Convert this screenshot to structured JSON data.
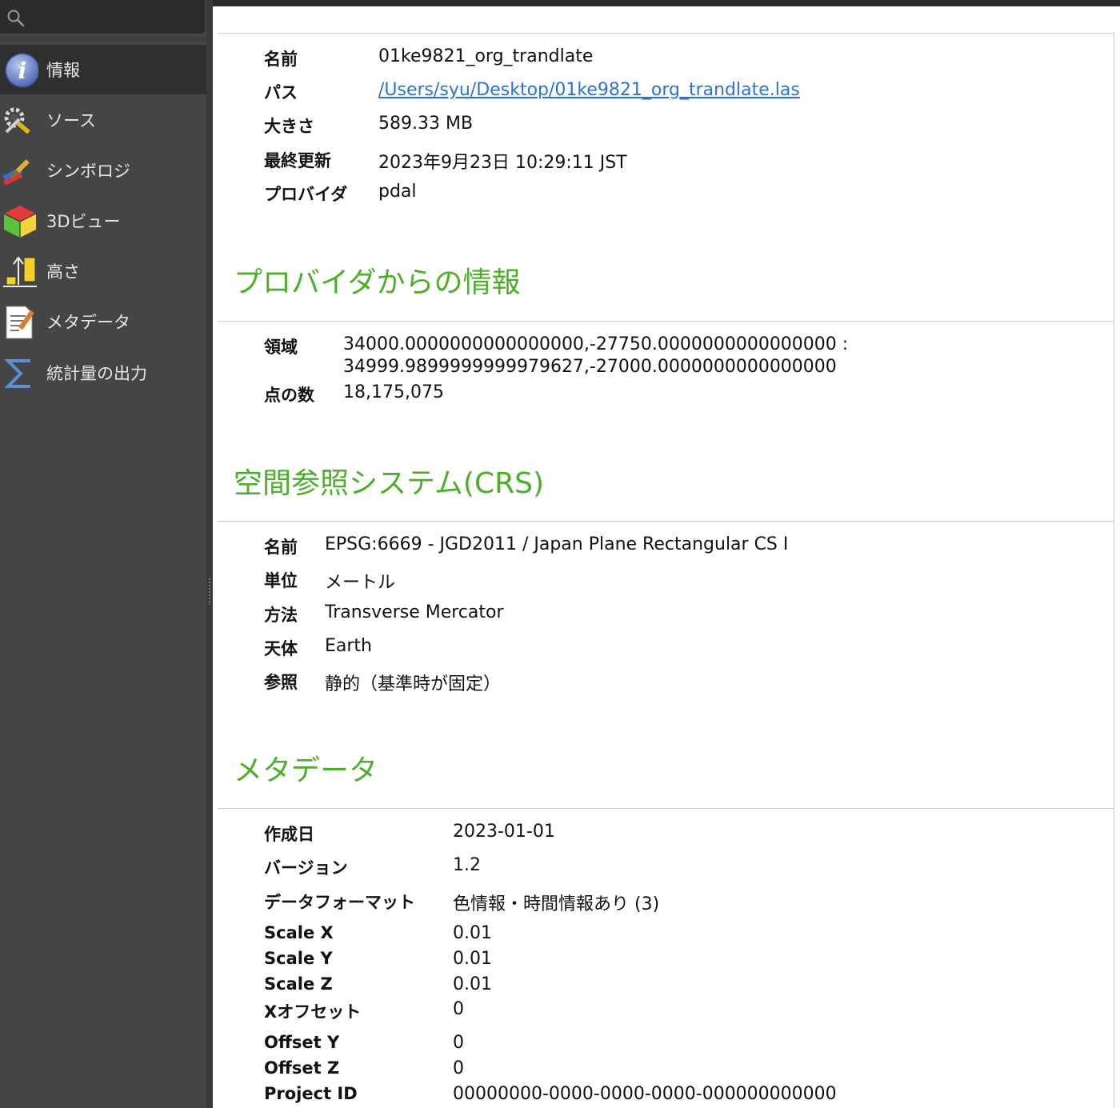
{
  "sidebar": {
    "search_placeholder": "",
    "items": [
      {
        "label": "情報",
        "icon": "info-icon",
        "active": true
      },
      {
        "label": "ソース",
        "icon": "tools-icon"
      },
      {
        "label": "シンボロジ",
        "icon": "paintbrush-icon"
      },
      {
        "label": "3Dビュー",
        "icon": "cube-3d-icon"
      },
      {
        "label": "高さ",
        "icon": "elevation-icon"
      },
      {
        "label": "メタデータ",
        "icon": "metadata-icon"
      },
      {
        "label": "統計量の出力",
        "icon": "sigma-icon"
      }
    ]
  },
  "general": {
    "rows": [
      {
        "key": "名前",
        "value": "01ke9821_org_trandlate"
      },
      {
        "key": "パス",
        "value": "/Users/syu/Desktop/01ke9821_org_trandlate.las"
      },
      {
        "key": "大きさ",
        "value": "589.33 MB"
      },
      {
        "key": "最終更新",
        "value": "2023年9月23日 10:29:11 JST"
      },
      {
        "key": "プロバイダ",
        "value": "pdal"
      }
    ]
  },
  "provider": {
    "title": "プロバイダからの情報",
    "rows": [
      {
        "key": "領域",
        "value": "34000.0000000000000000,-27750.0000000000000000 :",
        "value2": "34999.9899999999979627,-27000.0000000000000000"
      },
      {
        "key": "点の数",
        "value": "18,175,075"
      }
    ]
  },
  "crs": {
    "title": "空間参照システム(CRS)",
    "rows": [
      {
        "key": "名前",
        "value": "EPSG:6669 - JGD2011 / Japan Plane Rectangular CS I"
      },
      {
        "key": "単位",
        "value": "メートル"
      },
      {
        "key": "方法",
        "value": "Transverse Mercator"
      },
      {
        "key": "天体",
        "value": "Earth"
      },
      {
        "key": "参照",
        "value": "静的（基準時が固定）"
      }
    ]
  },
  "metadata": {
    "title": "メタデータ",
    "rows": [
      {
        "key": "作成日",
        "value": "2023-01-01"
      },
      {
        "key": "バージョン",
        "value": "1.2"
      },
      {
        "key": "データフォーマット",
        "value": "色情報・時間情報あり (3)"
      },
      {
        "key": "Scale X",
        "value": "0.01"
      },
      {
        "key": "Scale Y",
        "value": "0.01"
      },
      {
        "key": "Scale Z",
        "value": "0.01"
      },
      {
        "key": "Xオフセット",
        "value": "0"
      },
      {
        "key": "Offset Y",
        "value": "0"
      },
      {
        "key": "Offset Z",
        "value": "0"
      },
      {
        "key": "Project ID",
        "value": "00000000-0000-0000-0000-000000000000"
      }
    ]
  }
}
